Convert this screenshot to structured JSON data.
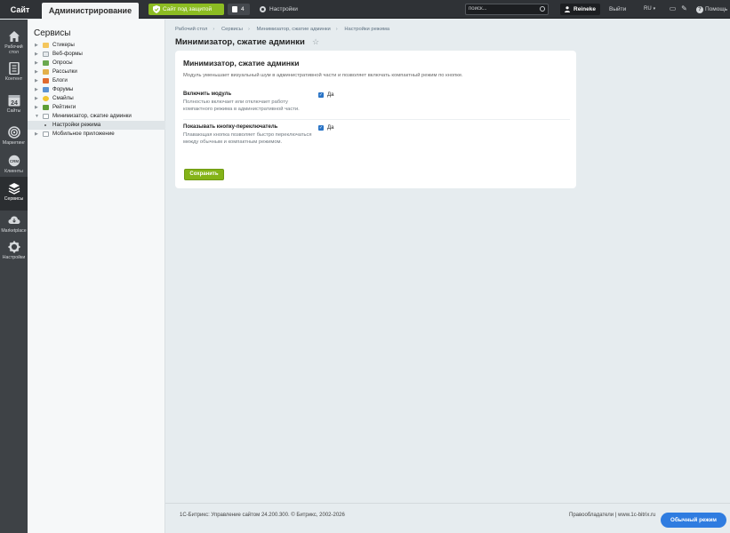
{
  "topbar": {
    "site_tab": "Сайт",
    "admin_tab": "Администрирование",
    "protect_label": "Сайт под защитой",
    "notifications_count": "4",
    "settings_label": "Настройки",
    "search_placeholder": "поиск...",
    "user_name": "Reineke",
    "logout_label": "Выйти",
    "lang": "RU",
    "help_label": "Помощь"
  },
  "leftmenu": [
    {
      "label": "Рабочий стол",
      "icon": "home-icon"
    },
    {
      "label": "Контент",
      "icon": "document-icon"
    },
    {
      "label": "Сайты",
      "icon": "calendar-icon",
      "badge": "24"
    },
    {
      "label": "Маркетинг",
      "icon": "target-icon"
    },
    {
      "label": "Клиенты",
      "icon": "crm-icon"
    },
    {
      "label": "Сервисы",
      "icon": "layers-icon"
    },
    {
      "label": "Marketplace",
      "icon": "cloud-icon"
    },
    {
      "label": "Настройки",
      "icon": "gear-icon"
    }
  ],
  "tree": {
    "title": "Сервисы",
    "items": [
      {
        "label": "Стикеры"
      },
      {
        "label": "Веб-формы"
      },
      {
        "label": "Опросы"
      },
      {
        "label": "Рассылки"
      },
      {
        "label": "Блоги"
      },
      {
        "label": "Форумы"
      },
      {
        "label": "Смайлы"
      },
      {
        "label": "Рейтинги"
      },
      {
        "label": "Минимизатор, сжатие админки"
      },
      {
        "label": "Настройки режима"
      },
      {
        "label": "Мобильное приложение"
      }
    ]
  },
  "breadcrumb": [
    "Рабочий стол",
    "Сервисы",
    "Минимизатор, сжатие админки",
    "Настройки режима"
  ],
  "page_title": "Минимизатор, сжатие админки",
  "card": {
    "title": "Минимизатор, сжатие админки",
    "description": "Модуль уменьшает визуальный шум в административной части и позволяет включать компактный режим по кнопке.",
    "option1": {
      "label": "Включить модуль",
      "hint": "Полностью включает или отключает работу компактного режима в административной части.",
      "value": "Да"
    },
    "option2": {
      "label": "Показывать кнопку-переключатель",
      "hint": "Плавающая кнопка позволяет быстро переключаться между обычным и компактным режимом.",
      "value": "Да"
    },
    "save_label": "Сохранить"
  },
  "footer": {
    "copyright": "1С-Битрикс: Управление сайтом 24.200.300. © Битрикс, 2002-2026",
    "right": "Правообладатели  |  www.1c-bitrix.ru"
  },
  "mode_button": "Обычный режим"
}
